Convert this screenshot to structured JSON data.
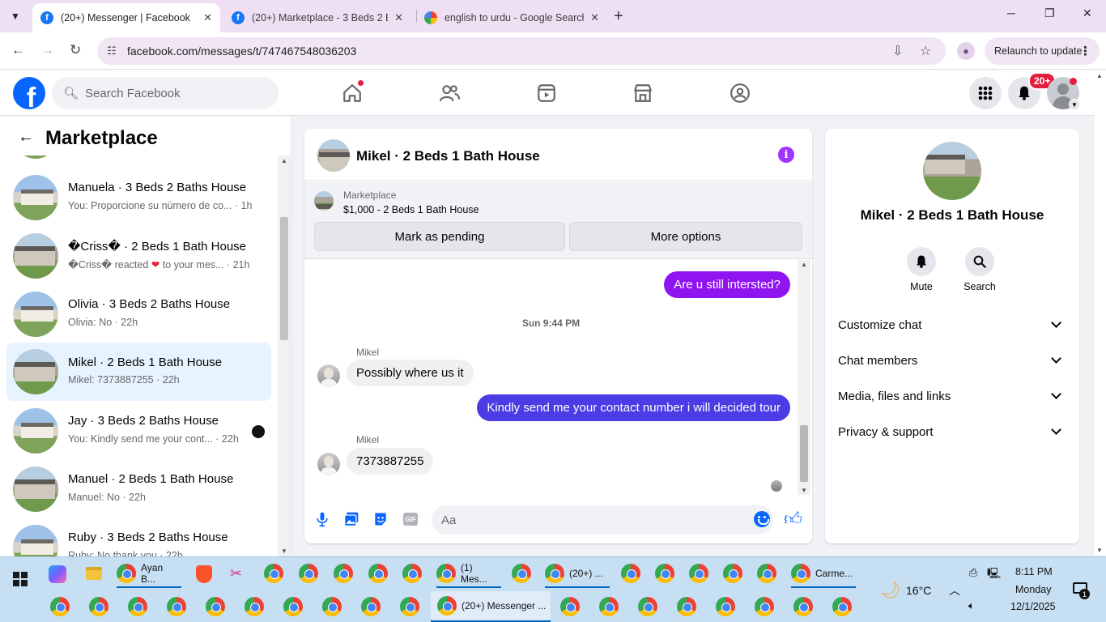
{
  "browser": {
    "tabs": [
      {
        "title": "(20+) Messenger | Facebook",
        "active": true
      },
      {
        "title": "(20+) Marketplace - 3 Beds 2 Ba",
        "active": false
      },
      {
        "title": "english to urdu - Google Search",
        "active": false
      }
    ],
    "url": "facebook.com/messages/t/747467548036203",
    "relaunch_label": "Relaunch to update"
  },
  "fb": {
    "search_placeholder": "Search Facebook",
    "notification_badge": "20+"
  },
  "sidebar": {
    "title": "Marketplace",
    "conversations": [
      {
        "name": "Manuela · 3 Beds 2 Baths House",
        "preview": "You: Proporcione su número de co...",
        "time": "· 1h"
      },
      {
        "name": "�Criss� · 2 Beds 1 Bath House",
        "preview_a": "�Criss� reacted",
        "preview_b": "to your mes...",
        "time": "· 21h"
      },
      {
        "name": "Olivia · 3 Beds 2 Baths House",
        "preview": "Olivia: No",
        "time": "· 22h"
      },
      {
        "name": "Mikel · 2 Beds 1 Bath House",
        "preview": "Mikel: 7373887255",
        "time": "· 22h"
      },
      {
        "name": "Jay · 3 Beds 2 Baths House",
        "preview": "You: Kindly send me your cont...",
        "time": "· 22h"
      },
      {
        "name": "Manuel · 2 Beds 1 Bath House",
        "preview": "Manuel: No",
        "time": "· 22h"
      },
      {
        "name": "Ruby · 3 Beds 2 Baths House",
        "preview": "Ruby: No thank you",
        "time": "· 22h"
      }
    ]
  },
  "chat": {
    "title": "Mikel · 2 Beds 1 Bath House",
    "marketplace_label": "Marketplace",
    "listing": "$1,000 - 2 Beds 1 Bath House",
    "mark_pending": "Mark as pending",
    "more_options": "More options",
    "messages": {
      "out1": "Are u still intersted?",
      "timestamp": "Sun 9:44 PM",
      "sender1": "Mikel",
      "in1": "Possibly where us it",
      "out2": "Kindly send me your contact number i will decided tour",
      "sender2": "Mikel",
      "in2": "7373887255"
    },
    "input_placeholder": "Aa"
  },
  "info": {
    "name": "Mikel · 2 Beds 1 Bath House",
    "mute": "Mute",
    "search": "Search",
    "rows": [
      "Customize chat",
      "Chat members",
      "Media, files and links",
      "Privacy & support"
    ]
  },
  "taskbar": {
    "apps": {
      "ayan": "Ayan B...",
      "messenger1": "(1) Mes...",
      "twenty": "(20+) ...",
      "carme": "Carme...",
      "messenger_active": "(20+) Messenger ..."
    },
    "weather": "16°C",
    "time": "8:11 PM",
    "day": "Monday",
    "date": "12/1/2025",
    "notifications": "1"
  }
}
